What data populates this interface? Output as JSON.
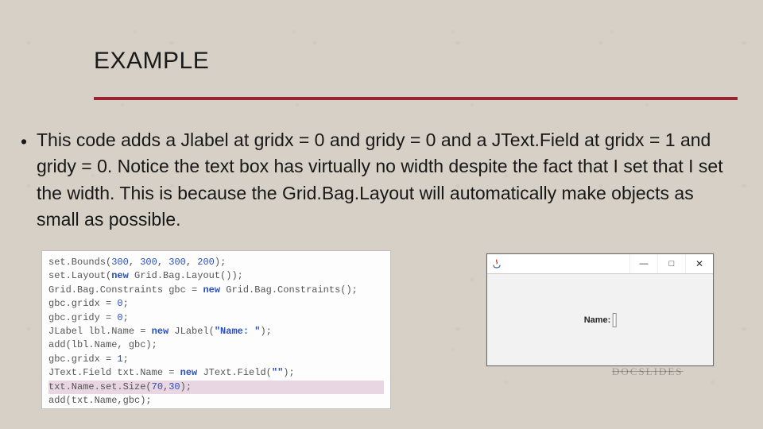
{
  "title": "EXAMPLE",
  "bullet_glyph": "•",
  "body": "This code adds a Jlabel at gridx = 0 and gridy = 0 and a JText.Field at gridx = 1 and gridy = 0.  Notice the text box has virtually no width despite the fact that I set that I set the width.   This is because the Grid.Bag.Layout will automatically make objects as small as possible.",
  "code": {
    "l1a": "set.Bounds(",
    "l1n1": "300",
    "l1c1": ", ",
    "l1n2": "300",
    "l1c2": ", ",
    "l1n3": "300",
    "l1c3": ", ",
    "l1n4": "200",
    "l1b": ");",
    "l2a": "set.Layout(",
    "l2kw": "new",
    "l2b": " Grid.Bag.Layout());",
    "l3a": "Grid.Bag.Constraints gbc = ",
    "l3kw": "new",
    "l3b": " Grid.Bag.Constraints();",
    "l4a": "gbc.gridx = ",
    "l4n": "0",
    "l4b": ";",
    "l5a": "gbc.gridy = ",
    "l5n": "0",
    "l5b": ";",
    "l6a": "JLabel lbl.Name = ",
    "l6kw": "new",
    "l6b": " JLabel(",
    "l6s": "\"Name: \"",
    "l6c": ");",
    "l7": "add(lbl.Name, gbc);",
    "l8a": "gbc.gridx = ",
    "l8n": "1",
    "l8b": ";",
    "l9a": "JText.Field txt.Name = ",
    "l9kw": "new",
    "l9b": " JText.Field(",
    "l9s": "\"\"",
    "l9c": ");",
    "l10a": "txt.Name.set.Size(",
    "l10n1": "70",
    "l10c": ",",
    "l10n2": "30",
    "l10b": ");",
    "l11": "add(txt.Name,gbc);"
  },
  "window": {
    "min": "—",
    "max": "□",
    "close": "✕",
    "field_label": "Name: "
  },
  "stamp": "DOCSLIDES"
}
